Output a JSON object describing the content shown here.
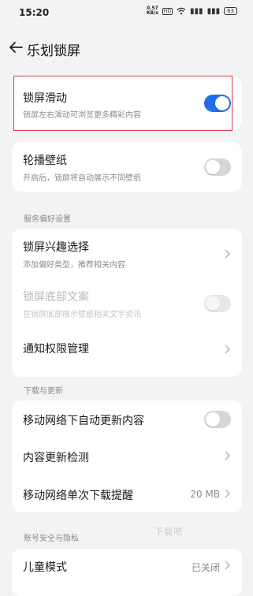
{
  "status": {
    "time": "15:20",
    "net_speed_value": "0.57",
    "net_speed_unit": "KB/s",
    "hd_label": "HD",
    "battery": "63"
  },
  "header": {
    "title": "乐划锁屏"
  },
  "card1": {
    "title": "锁屏滑动",
    "subtitle": "锁屏左右滑动可浏览更多精彩内容",
    "toggle_on": true
  },
  "card2": {
    "title": "轮播壁纸",
    "subtitle": "开启后，锁屏将自动展示不同壁纸",
    "toggle_on": false
  },
  "section_service": {
    "title": "服务偏好设置",
    "items": [
      {
        "title": "锁屏兴趣选择",
        "subtitle": "添加偏好类型，推荐相关内容"
      },
      {
        "title": "锁屏底部文案",
        "subtitle": "在锁屏底部展示壁纸相关文字资讯",
        "disabled": true
      },
      {
        "title": "通知权限管理"
      }
    ]
  },
  "section_download": {
    "title": "下载与更新",
    "items": [
      {
        "title": "移动网络下自动更新内容"
      },
      {
        "title": "内容更新检测"
      },
      {
        "title": "移动网络单次下载提醒",
        "value": "20 MB"
      }
    ]
  },
  "section_privacy": {
    "title": "账号安全与隐私",
    "items": [
      {
        "title": "儿童模式",
        "value": "已关闭"
      }
    ]
  },
  "watermark": "下载吧"
}
